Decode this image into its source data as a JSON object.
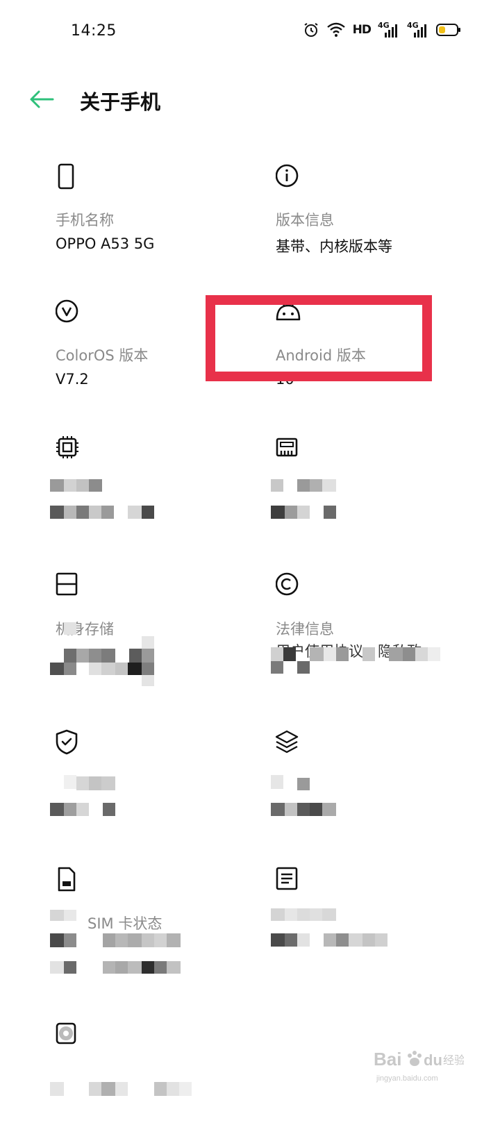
{
  "status_bar": {
    "time": "14:25",
    "hd_label": "HD",
    "sim1_label": "4G",
    "sim2_label": "4G"
  },
  "header": {
    "title": "关于手机"
  },
  "items": {
    "phone_name": {
      "label": "手机名称",
      "value": "OPPO A53 5G"
    },
    "version_info": {
      "label": "版本信息",
      "value": "基带、内核版本等"
    },
    "coloros_version": {
      "label": "ColorOS 版本",
      "value": "V7.2"
    },
    "android_version": {
      "label": "Android 版本",
      "value": "10"
    },
    "storage": {
      "label": "机身存储"
    },
    "legal": {
      "label": "法律信息",
      "value": "用户使用协议、隐私政"
    },
    "sim": {
      "label": "SIM 卡状态"
    }
  },
  "colors": {
    "accent_green": "#2ec07a",
    "highlight_red": "#e8314a",
    "label_gray": "#8a8a8a"
  },
  "icons": [
    "back-arrow-icon",
    "alarm-icon",
    "wifi-icon",
    "signal-icon",
    "battery-icon",
    "phone-icon",
    "info-icon",
    "coloros-icon",
    "android-icon",
    "cpu-icon",
    "ram-icon",
    "storage-icon",
    "copyright-icon",
    "shield-check-icon",
    "layers-icon",
    "sim-card-icon",
    "document-icon",
    "camera-icon"
  ]
}
